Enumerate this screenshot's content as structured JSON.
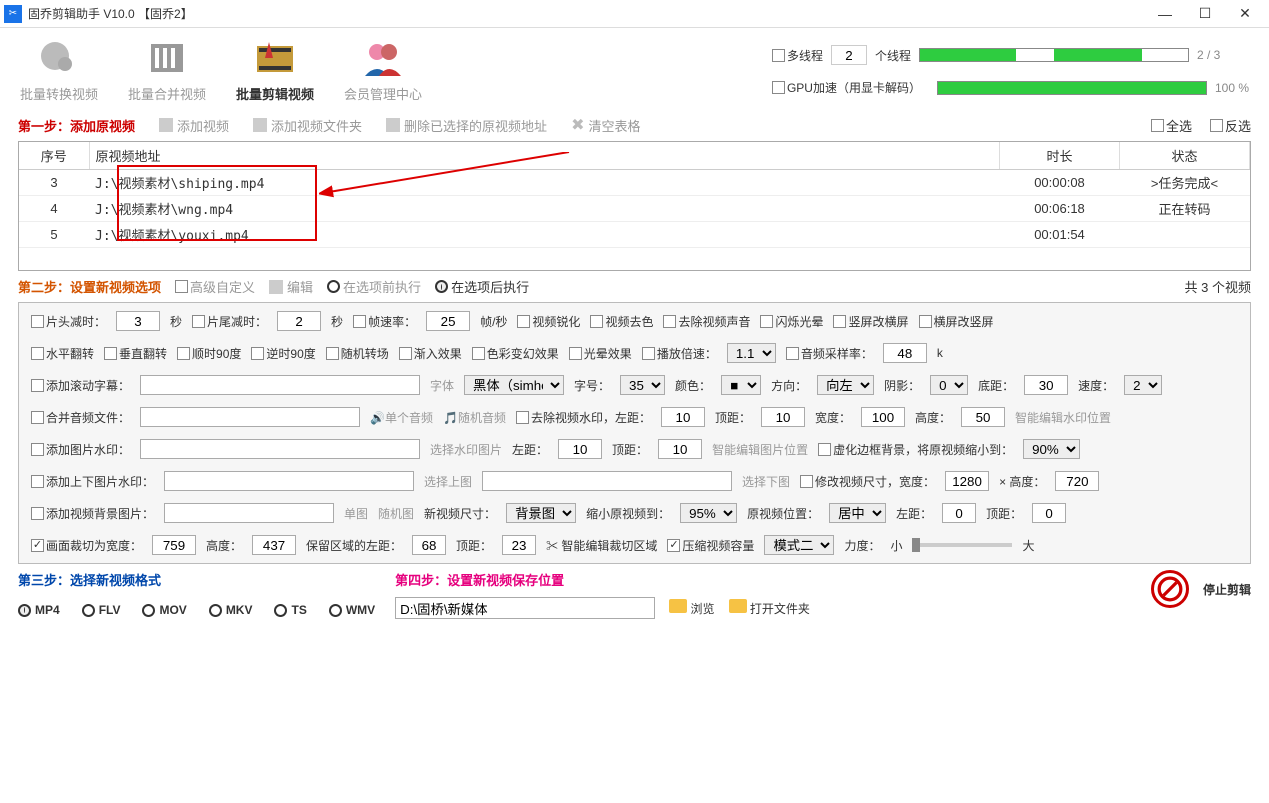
{
  "window": {
    "title": "固乔剪辑助手 V10.0  【固乔2】"
  },
  "toolbar": {
    "items": [
      {
        "label": "批量转换视频"
      },
      {
        "label": "批量合并视频"
      },
      {
        "label": "批量剪辑视频"
      },
      {
        "label": "会员管理中心"
      }
    ],
    "multithread": {
      "checkbox_label": "多线程",
      "value": "2",
      "suffix": "个线程"
    },
    "gpu": {
      "label": "GPU加速（用显卡解码）"
    },
    "progress1_text": "2 / 3",
    "progress2_text": "100 %"
  },
  "step1": {
    "title": "第一步：添加原视频",
    "add_video": "添加视频",
    "add_folder": "添加视频文件夹",
    "delete_selected": "删除已选择的原视频地址",
    "clear_table": "清空表格",
    "select_all": "全选",
    "invert": "反选",
    "headers": {
      "seq": "序号",
      "path": "原视频地址",
      "duration": "时长",
      "status": "状态"
    },
    "rows": [
      {
        "seq": "3",
        "path": "J:\\视频素材\\shiping.mp4",
        "duration": "00:00:08",
        "status": ">任务完成<"
      },
      {
        "seq": "4",
        "path": "J:\\视频素材\\wng.mp4",
        "duration": "00:06:18",
        "status": "正在转码"
      },
      {
        "seq": "5",
        "path": "J:\\视频素材\\youxi.mp4",
        "duration": "00:01:54",
        "status": ""
      }
    ]
  },
  "step2": {
    "title": "第二步：设置新视频选项",
    "advanced": "高级自定义",
    "edit": "编辑",
    "before": "在选项前执行",
    "after": "在选项后执行",
    "total": "共 3 个视频"
  },
  "opts": {
    "head_trim": "片头减时：",
    "head_trim_val": "3",
    "sec": "秒",
    "tail_trim": "片尾减时：",
    "tail_trim_val": "2",
    "fps": "帧速率：",
    "fps_val": "25",
    "fps_unit": "帧/秒",
    "sharpen": "视频锐化",
    "desat": "视频去色",
    "mute": "去除视频声音",
    "flash": "闪烁光晕",
    "vert2horiz": "竖屏改横屏",
    "horiz2vert": "横屏改竖屏",
    "hflip": "水平翻转",
    "vflip": "垂直翻转",
    "cw90": "顺时90度",
    "ccw90": "逆时90度",
    "rand_trans": "随机转场",
    "fade": "渐入效果",
    "color_shift": "色彩变幻效果",
    "halo": "光晕效果",
    "speed": "播放倍速：",
    "speed_val": "1.1",
    "audio_rate": "音频采样率：",
    "audio_rate_val": "48",
    "k": "k",
    "scroll_text": "添加滚动字幕：",
    "font": "字体",
    "font_val": "黑体（simhei）",
    "font_size": "字号：",
    "font_size_val": "35",
    "color": "颜色：",
    "dir": "方向：",
    "dir_val": "向左",
    "shadow": "阴影：",
    "shadow_val": "0",
    "bottom_margin": "底距：",
    "bottom_margin_val": "30",
    "speed2": "速度：",
    "speed2_val": "2",
    "merge_audio": "合并音频文件：",
    "single_audio": "单个音频",
    "random_audio": "随机音频",
    "remove_watermark": "去除视频水印，左距：",
    "wm_left": "10",
    "wm_top_lbl": "顶距：",
    "wm_top": "10",
    "wm_w_lbl": "宽度：",
    "wm_w": "100",
    "wm_h_lbl": "高度：",
    "wm_h": "50",
    "smart_wm": "智能编辑水印位置",
    "img_wm": "添加图片水印：",
    "choose_wm": "选择水印图片",
    "left_lbl": "左距：",
    "img_left": "10",
    "img_top": "10",
    "smart_img": "智能编辑图片位置",
    "blur_border": "虚化边框背景，将原视频缩小到：",
    "blur_pct": "90%",
    "topbot_img": "添加上下图片水印：",
    "choose_top": "选择上图",
    "choose_bot": "选择下图",
    "resize": "修改视频尺寸，宽度：",
    "resize_w": "1280",
    "x": "× 高度：",
    "resize_h": "720",
    "bg_img": "添加视频背景图片：",
    "single_img": "单图",
    "random_img": "随机图",
    "new_size": "新视频尺寸：",
    "new_size_val": "背景图",
    "shrink": "缩小原视频到：",
    "shrink_val": "95%",
    "pos": "原视频位置：",
    "pos_val": "居中",
    "pos_left": "0",
    "pos_top": "0",
    "crop": "画面裁切为宽度：",
    "crop_w": "759",
    "crop_h_lbl": "高度：",
    "crop_h": "437",
    "keep_left": "保留区域的左距：",
    "keep_left_val": "68",
    "keep_top": "23",
    "smart_crop": "智能编辑裁切区域",
    "compress": "压缩视频容量",
    "mode": "模式二",
    "strength": "力度：",
    "small": "小",
    "large": "大"
  },
  "step3": {
    "title": "第三步：选择新视频格式",
    "formats": [
      "MP4",
      "FLV",
      "MOV",
      "MKV",
      "TS",
      "WMV"
    ]
  },
  "step4": {
    "title": "第四步：设置新视频保存位置",
    "path": "D:\\固桥\\新媒体",
    "browse": "浏览",
    "open_folder": "打开文件夹",
    "stop": "停止剪辑"
  }
}
